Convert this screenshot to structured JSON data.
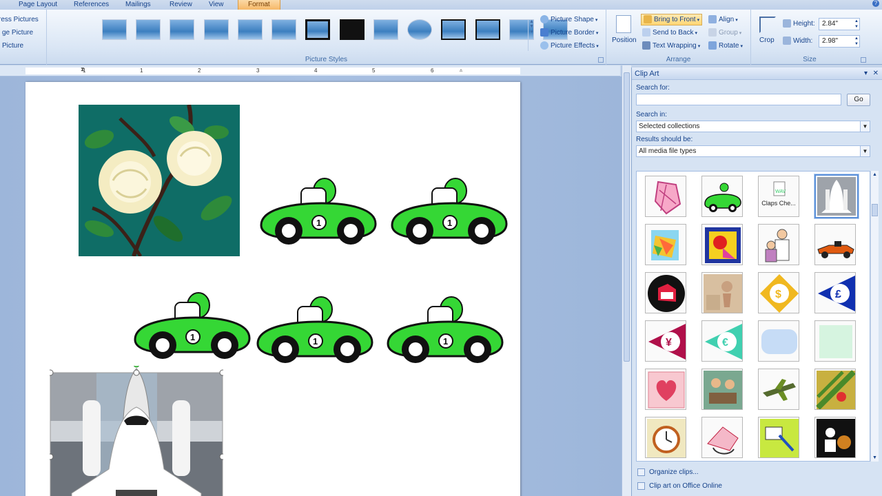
{
  "ribbon": {
    "tabs": [
      "Page Layout",
      "References",
      "Mailings",
      "Review",
      "View",
      "Format"
    ],
    "left_group": {
      "items": [
        "ress Pictures",
        "ge Picture",
        "Picture"
      ]
    },
    "picture_styles": {
      "label": "Picture Styles",
      "shape": "Picture Shape",
      "border": "Picture Border",
      "effects": "Picture Effects"
    },
    "arrange": {
      "label": "Arrange",
      "position": "Position",
      "bring_to_front": "Bring to Front",
      "send_to_back": "Send to Back",
      "text_wrapping": "Text Wrapping",
      "align": "Align",
      "group": "Group",
      "rotate": "Rotate"
    },
    "size": {
      "label": "Size",
      "crop": "Crop",
      "height_label": "Height:",
      "height_value": "2.84\"",
      "width_label": "Width:",
      "width_value": "2.98\""
    },
    "help": "?"
  },
  "ruler": {
    "numbers": [
      "1",
      "1",
      "2",
      "3",
      "4",
      "5",
      "6"
    ]
  },
  "clip_art": {
    "title": "Clip Art",
    "search_for_label": "Search for:",
    "search_value": "",
    "go_label": "Go",
    "search_in_label": "Search in:",
    "search_in_value": "Selected collections",
    "results_label": "Results should be:",
    "results_value": "All media file types",
    "claps_caption": "Claps Che...",
    "organize_link": "Organize clips...",
    "online_link": "Clip art on Office Online"
  },
  "colors": {
    "car_green": "#35d735",
    "rose_bg": "#0f6d66",
    "accent_orange": "#f6b868"
  }
}
